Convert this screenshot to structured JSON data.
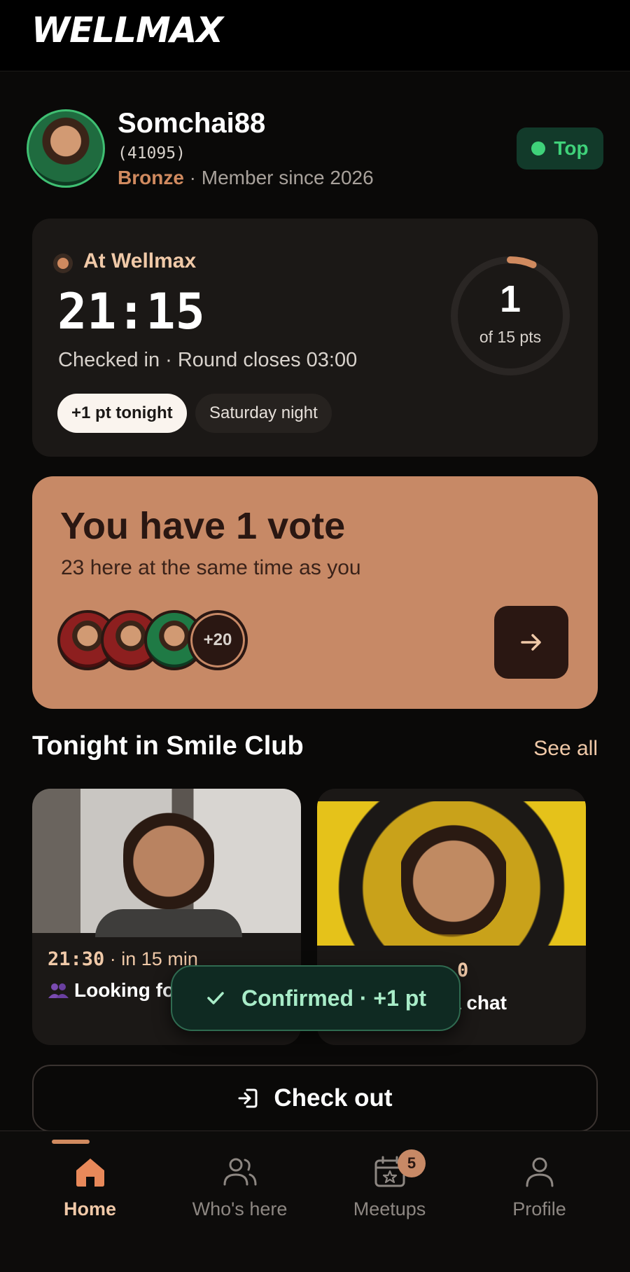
{
  "app": {
    "brand": "WELLMAX"
  },
  "profile": {
    "username": "Somchai88",
    "user_id": "(41095)",
    "tier": "Bronze",
    "member_since": " · Member since 2026",
    "status": "Top"
  },
  "checkin": {
    "location": "At Wellmax",
    "time": "21:15",
    "subtitle": "Checked in · Round closes 03:00",
    "chips": [
      "+1 pt tonight",
      "Saturday night"
    ],
    "points": "1",
    "points_of": "of 15 pts",
    "progress": 0.0667
  },
  "vote": {
    "title": "You have 1 vote",
    "subtitle": "23 here at the same time as you",
    "more_count": "+20"
  },
  "section": {
    "title": "Tonight in Smile Club",
    "see_all": "See all"
  },
  "events": [
    {
      "time": "21:30",
      "time_suffix": " · in 15 min",
      "description": "Looking for a group",
      "icon": "people-icon"
    },
    {
      "time": "0",
      "description": "a chat"
    }
  ],
  "toast": {
    "label": "Confirmed · +1 pt"
  },
  "checkout": {
    "label": "Check out"
  },
  "tabs": [
    {
      "label": "Home",
      "icon": "home-icon",
      "active": true
    },
    {
      "label": "Who's here",
      "icon": "users-icon"
    },
    {
      "label": "Meetups",
      "icon": "calendar-star-icon",
      "badge": "5"
    },
    {
      "label": "Profile",
      "icon": "user-icon"
    }
  ],
  "colors": {
    "accent": "#d08a5f",
    "vote_card": "#c78966",
    "success": "#3fd27a",
    "background": "#0a0908"
  }
}
